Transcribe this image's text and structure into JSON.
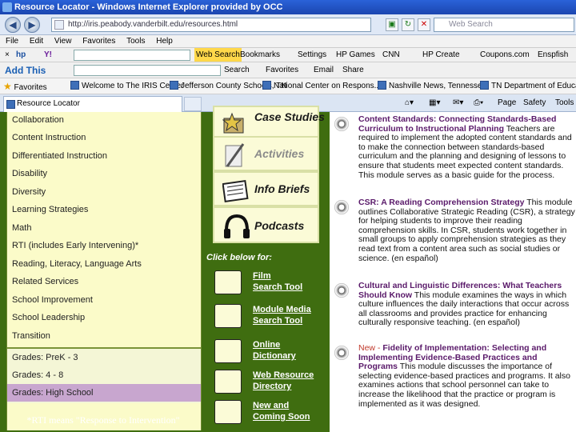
{
  "window": {
    "title": "Resource Locator - Windows Internet Explorer provided by OCC"
  },
  "address_bar": {
    "url": "http://iris.peabody.vanderbilt.edu/resources.html",
    "search_placeholder": "Web Search"
  },
  "menu": [
    "File",
    "Edit",
    "View",
    "Favorites",
    "Tools",
    "Help"
  ],
  "toolbar1": {
    "close": "×",
    "items": [
      "Web Search",
      "Bookmarks",
      "Settings",
      "HP Games",
      "CNN",
      "HP Create",
      "Coupons.com",
      "Enspfish"
    ]
  },
  "toolbar2": {
    "add_this": "Add This",
    "search": "Search",
    "favorites": "Favorites",
    "email": "Email",
    "share": "Share"
  },
  "favorites_bar": {
    "label": "Favorites",
    "items": [
      "Welcome to The IRIS Center",
      "Jefferson County Schools, TN",
      "National Center on Respons...",
      "Nashville News, Tennessee",
      "TN Department of Education"
    ]
  },
  "tab": {
    "title": "Resource Locator"
  },
  "command_bar": {
    "page": "Page",
    "safety": "Safety",
    "tools": "Tools"
  },
  "categories": [
    "Collaboration",
    "Content Instruction",
    "Differentiated Instruction",
    "Disability",
    "Diversity",
    "Learning Strategies",
    "Math",
    "RTI (includes Early Intervening)*",
    "Reading, Literacy, Language Arts",
    "Related Services",
    "School Improvement",
    "School Leadership",
    "Transition"
  ],
  "grades": [
    "Grades: PreK - 3",
    "Grades: 4 - 8",
    "Grades: High School"
  ],
  "footnote": "*RTI means \"Response to Intervention\"",
  "resource_buttons": [
    "Case Studies",
    "Activities",
    "Info Briefs",
    "Podcasts"
  ],
  "click_below": "Click below for:",
  "tools": [
    {
      "line1": "Film",
      "line2": "Search Tool"
    },
    {
      "line1": "Module Media",
      "line2": "Search Tool"
    },
    {
      "line1": "Online",
      "line2": "Dictionary"
    },
    {
      "line1": "Web Resource",
      "line2": "Directory"
    },
    {
      "line1": "New and",
      "line2": "Coming Soon"
    }
  ],
  "modules": [
    {
      "new": "",
      "title": "Content Standards: Connecting Standards-Based Curriculum to Instructional Planning",
      "body": " Teachers are required to implement the adopted content standards and to make the connection between standards-based curriculum and the planning and designing of lessons to ensure that students meet expected content standards. This module serves as a basic guide for the process."
    },
    {
      "new": "",
      "title": "CSR: A Reading Comprehension Strategy",
      "body": " This module outlines Collaborative Strategic Reading (CSR), a strategy for helping students to improve their reading comprehension skills. In CSR, students work together in small groups to apply comprehension strategies as they read text from a content area such as social studies or science. (en español)"
    },
    {
      "new": "",
      "title": "Cultural and Linguistic Differences: What Teachers Should Know",
      "body": " This module examines the ways in which culture influences the daily interactions that occur across all classrooms and provides practice for enhancing culturally responsive teaching. (en español)"
    },
    {
      "new": "New - ",
      "title": "Fidelity of Implementation: Selecting and Implementing Evidence-Based Practices and Programs",
      "body": " This module discusses the importance of selecting evidence-based practices and programs. It also examines actions that school personnel can take to increase the likelihood that the practice or program is implemented as it was designed."
    }
  ]
}
